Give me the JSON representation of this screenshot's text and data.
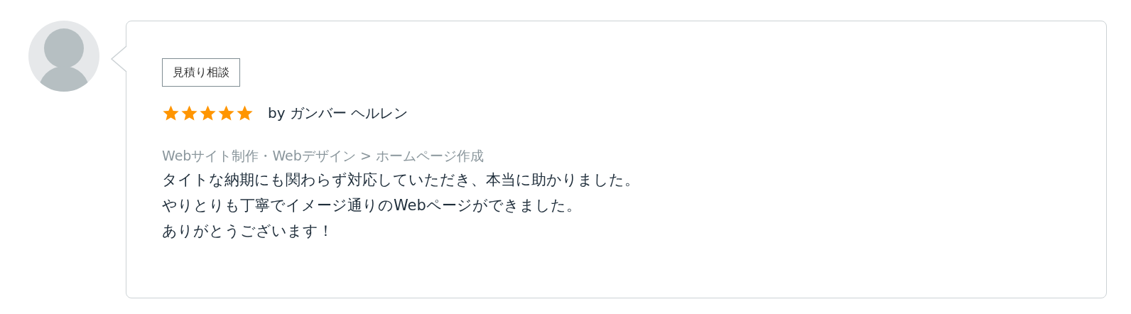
{
  "review": {
    "tag": "見積り相談",
    "stars": 5,
    "author": "by ガンバー ヘルレン",
    "category": "Webサイト制作・Webデザイン > ホームページ作成",
    "comment_lines": [
      "タイトな納期にも関わらず対応していただき、本当に助かりました。",
      "やりとりも丁寧でイメージ通りのWebページができました。",
      "ありがとうございます！"
    ]
  }
}
